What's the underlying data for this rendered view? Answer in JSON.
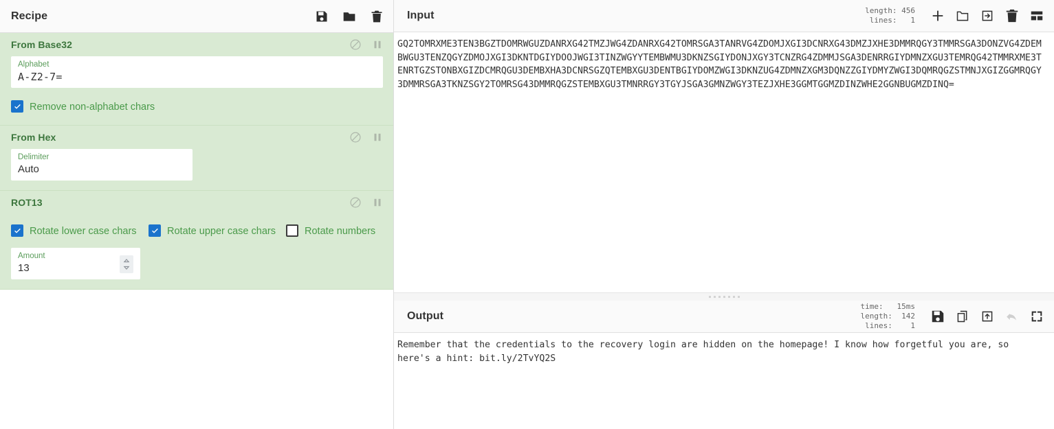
{
  "recipe": {
    "title": "Recipe",
    "header_icons": [
      {
        "name": "save-recipe-icon",
        "label": "Save recipe"
      },
      {
        "name": "load-recipe-icon",
        "label": "Load recipe"
      },
      {
        "name": "clear-recipe-icon",
        "label": "Clear recipe"
      }
    ],
    "operations": [
      {
        "name": "From Base32",
        "disable_label": "Disable operation",
        "pause_label": "Set breakpoint",
        "args": [
          {
            "type": "text",
            "label": "Alphabet",
            "value": "A-Z2-7="
          }
        ],
        "checkboxes": [
          {
            "label": "Remove non-alphabet chars",
            "checked": true
          }
        ]
      },
      {
        "name": "From Hex",
        "disable_label": "Disable operation",
        "pause_label": "Set breakpoint",
        "args": [
          {
            "type": "text",
            "label": "Delimiter",
            "value": "Auto"
          }
        ],
        "checkboxes": []
      },
      {
        "name": "ROT13",
        "disable_label": "Disable operation",
        "pause_label": "Set breakpoint",
        "args": [
          {
            "type": "number",
            "label": "Amount",
            "value": "13"
          }
        ],
        "checkboxes": [
          {
            "label": "Rotate lower case chars",
            "checked": true
          },
          {
            "label": "Rotate upper case chars",
            "checked": true
          },
          {
            "label": "Rotate numbers",
            "checked": false
          }
        ]
      }
    ]
  },
  "input": {
    "title": "Input",
    "stats": {
      "length_label": "length:",
      "length_value": "456",
      "lines_label": "lines:",
      "lines_value": "1"
    },
    "icons": [
      {
        "name": "add-input-tab-icon",
        "label": "Add a new input tab"
      },
      {
        "name": "open-folder-icon",
        "label": "Open file as input"
      },
      {
        "name": "open-folder-into-icon",
        "label": "Open folder as input"
      },
      {
        "name": "clear-input-icon",
        "label": "Clear input and output"
      },
      {
        "name": "reset-pane-layout-icon",
        "label": "Reset pane layout"
      }
    ],
    "value": "GQ2TOMRXME3TEN3BGZTDOMRWGUZDANRXG42TMZJWG4ZDANRXG42TOMRSGA3TANRVG4ZDOMJXGI3DCNRXG43DMZJXHE3DMMRQGY3TMMRSGA3DONZVG4ZDEMBWGU3TENZQGYZDMOJXGI3DKNTDGIYDOOJWGI3TINZWGYYTEMBWMU3DKNZSGIYDONJXGY3TCNZRG4ZDMMJSGA3DENRRGIYDMNZXGU3TEMRQG42TMMRXME3TENRTGZSTONBXGIZDCMRQGU3DEMBXHA3DCNRSGZQTEMBXGU3DENTBGIYDOMZWGI3DKNZUG4ZDMNZXGM3DQNZZGIYDMYZWGI3DQMRQGZSTMNJXGIZGGMRQGY3DMMRSGA3TKNZSGY2TOMRSG43DMMRQGZSTEMBXGU3TMNRRGY3TGYJSGA3GMNZWGY3TEZJXHE3GGMTGGMZDINZWHE2GGNBUGMZDINQ="
  },
  "output": {
    "title": "Output",
    "stats": {
      "time_label": "time:",
      "time_value": "15ms",
      "length_label": "length:",
      "length_value": "142",
      "lines_label": "lines:",
      "lines_value": "1"
    },
    "icons": [
      {
        "name": "save-output-icon",
        "label": "Save output to file"
      },
      {
        "name": "copy-output-icon",
        "label": "Copy raw output to the clipboard"
      },
      {
        "name": "replace-input-icon",
        "label": "Replace input with output"
      },
      {
        "name": "undo-bake-icon",
        "label": "Step through the recipe",
        "disabled": true
      },
      {
        "name": "maximise-output-icon",
        "label": "Maximise output pane"
      }
    ],
    "value": "Remember that the credentials to the recovery login are hidden on the homepage! I know how forgetful you are, so here's a hint: bit.ly/2TvYQ2S"
  },
  "colors": {
    "operation_bg": "#d9ead3",
    "operation_text": "#3c763d",
    "checkbox_on": "#1a73cc",
    "label_green": "#5a9c5a"
  }
}
